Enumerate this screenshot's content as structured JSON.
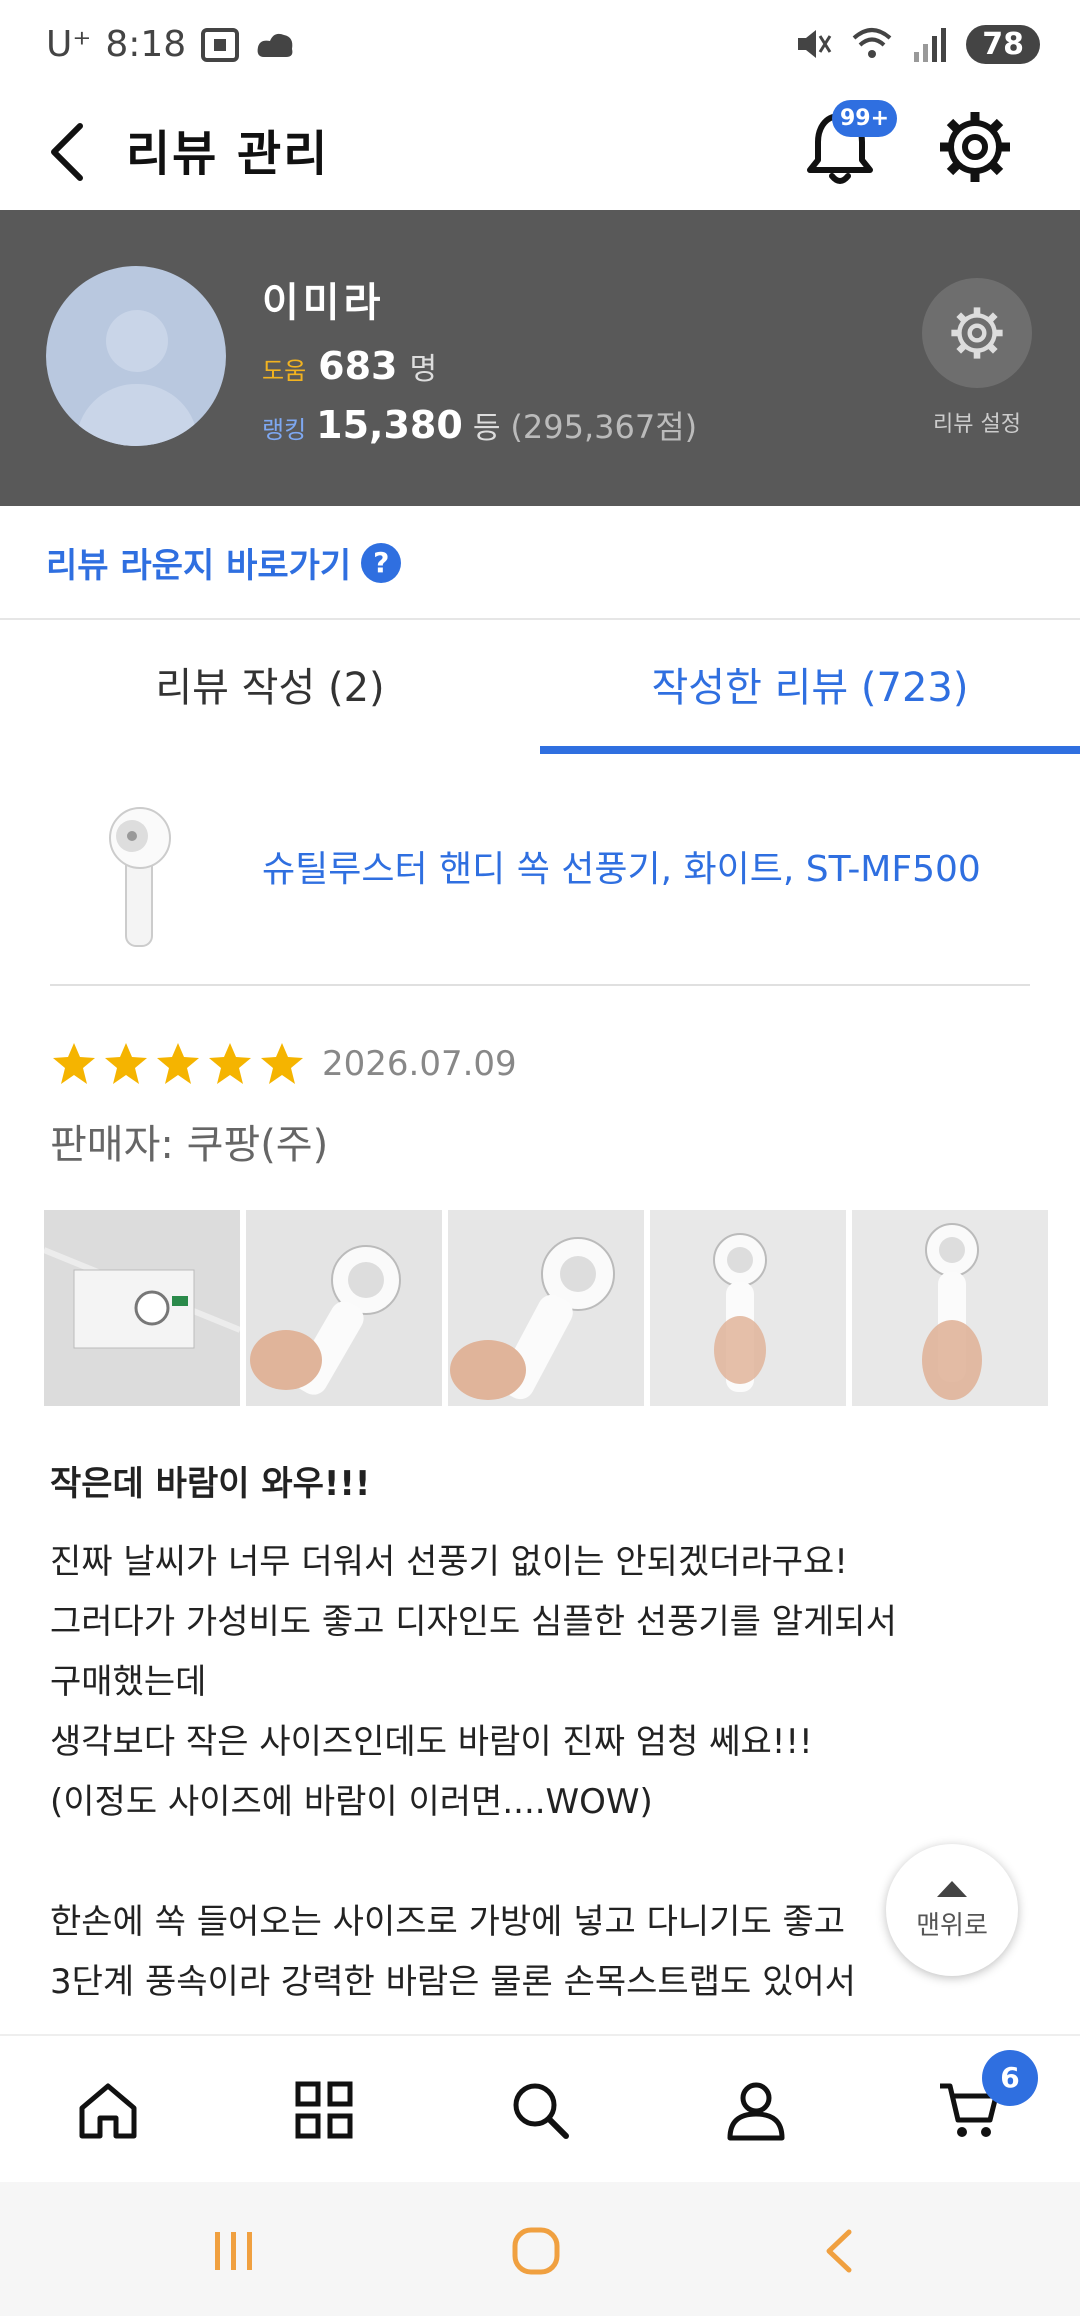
{
  "status_bar": {
    "carrier": "U⁺",
    "time": "8:18",
    "battery": "78"
  },
  "header": {
    "title": "리뷰 관리",
    "notification_badge": "99+"
  },
  "profile": {
    "name": "이미라",
    "help_label": "도움",
    "help_count": "683",
    "help_unit": "명",
    "rank_label": "랭킹",
    "rank_value": "15,380",
    "rank_unit": "등",
    "points": "(295,367점)",
    "review_settings_label": "리뷰 설정"
  },
  "lounge": {
    "label": "리뷰 라운지 바로가기",
    "help_icon": "?"
  },
  "tabs": [
    {
      "label": "리뷰 작성 (2)"
    },
    {
      "label": "작성한 리뷰 (723)"
    }
  ],
  "product": {
    "name": "슈틸루스터 핸디 쏙 선풍기, 화이트, ST-MF500"
  },
  "review": {
    "rating": 5,
    "date": "2026.07.09",
    "seller": "판매자: 쿠팡(주)",
    "title": "작은데 바람이 와우!!!",
    "lines": [
      "진짜 날씨가 너무 더워서 선풍기 없이는 안되겠더라구요!",
      "그러다가 가성비도 좋고 디자인도 심플한 선풍기를 알게되서",
      "구매했는데",
      "생각보다 작은 사이즈인데도 바람이 진짜 엄청 쎄요!!!",
      "(이정도 사이즈에 바람이 이러면....WOW)",
      "",
      "한손에 쏙 들어오는 사이즈로 가방에 넣고 다니기도 좋고",
      "3단계 풍속이라 강력한 바람은 물론 손목스트랩도 있어서"
    ]
  },
  "to_top": {
    "label": "맨위로"
  },
  "bottom_nav": {
    "cart_badge": "6"
  },
  "colors": {
    "accent": "#2f6fe0",
    "profile_bg": "#595959",
    "star": "#f5b400"
  }
}
